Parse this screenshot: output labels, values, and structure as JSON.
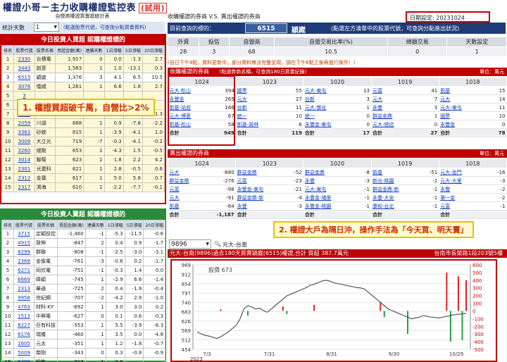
{
  "title": {
    "main": "權證小哥－主力收購權證監控表",
    "note": "(試用)"
  },
  "date_setting": {
    "label": "日期設定:",
    "value": "20231024"
  },
  "left": {
    "header": "自營商權證買賣超統計表",
    "stat_days_label": "統計天數",
    "stat_days_value": "1",
    "stat_hint": "(點選股票代號，可查詢分點買賣資料)",
    "top_title": "今日投資人買超 認購權證標的",
    "top_cols": [
      "排名",
      "股票代號",
      "股票名稱",
      "買超金額(萬)",
      "連續天數",
      "1日漲幅",
      "5日漲幅",
      "20日漲幅"
    ],
    "top_rows": [
      [
        "1",
        "2330",
        "台積電",
        "1,917",
        "0",
        "0.0",
        "-1.3",
        "2.7"
      ],
      [
        "2",
        "3443",
        "創意",
        "1,583",
        "1",
        "1.0",
        "-13.1",
        "0.3"
      ],
      [
        "3",
        "6515",
        "穎崴",
        "1,376",
        "3",
        "4.1",
        "6.5",
        "10.5"
      ],
      [
        "4",
        "3078",
        "僑威",
        "1,261",
        "1",
        "6.6",
        "1.8",
        "2.7"
      ],
      [
        "5",
        "3",
        "",
        "",
        "",
        "",
        "",
        ""
      ],
      [
        "6",
        "3",
        "",
        "",
        "",
        "",
        "",
        ""
      ],
      [
        "7",
        "3324",
        "雙鴻",
        "912",
        "1",
        "3.8",
        "0.5",
        "1.3"
      ],
      [
        "8",
        "2059",
        "川湖",
        "888",
        "1",
        "0.9",
        "-7.8",
        "-2.2"
      ],
      [
        "9",
        "3363",
        "砂統",
        "815",
        "1",
        "-3.9",
        "-4.1",
        "1.0"
      ],
      [
        "10",
        "3008",
        "大立光",
        "719",
        "-7",
        "-0.3",
        "-4.1",
        "-0.2"
      ],
      [
        "11",
        "3260",
        "威剛",
        "653",
        "1",
        "-4.3",
        "1.5",
        "-0.5"
      ],
      [
        "12",
        "3014",
        "聯陽",
        "623",
        "1",
        "1.8",
        "2.2",
        "4.2"
      ],
      [
        "13",
        "2301",
        "光寶科",
        "621",
        "1",
        "2.8",
        "-0.5",
        "0.6"
      ],
      [
        "14",
        "2312",
        "金寶",
        "617",
        "1",
        "5.0",
        "5.8",
        "0.7"
      ],
      [
        "15",
        "2317",
        "鴻海",
        "610",
        "1",
        "-2.2",
        "-7.7",
        "-0.1"
      ]
    ],
    "bottom_title": "今日投資人賣超 認購權證標的",
    "bottom_cols": [
      "排名",
      "股票代號",
      "股票名稱",
      "賣超金額(萬)",
      "連續天數",
      "1日漲幅",
      "5日漲幅",
      "20日漲幅"
    ],
    "bottom_rows": [
      [
        "1",
        "3715",
        "定穎投控",
        "-1,460",
        "-1",
        "-5.3",
        "-11.5",
        "-0.6"
      ],
      [
        "2",
        "4915",
        "致伸",
        "-847",
        "2",
        "0.4",
        "0.9",
        "-1.7"
      ],
      [
        "3",
        "8299",
        "群聯",
        "-808",
        "-1",
        "-2.5",
        "-3.0",
        "-3.1"
      ],
      [
        "4",
        "2368",
        "金像電",
        "-761",
        "-3",
        "-0.6",
        "0.2",
        "-1.7"
      ],
      [
        "5",
        "6271",
        "同欣電",
        "-751",
        "-1",
        "-0.3",
        "1.4",
        "0.0"
      ],
      [
        "6",
        "6669",
        "緯穎",
        "-745",
        "1",
        "-2.9",
        "6.6",
        "-1.4"
      ],
      [
        "7",
        "2313",
        "華通",
        "-725",
        "2",
        "0.4",
        "-1.9",
        "-0.4"
      ],
      [
        "8",
        "9958",
        "世紀鋼",
        "-707",
        "-2",
        "-4.2",
        "2.9",
        "-1.0"
      ],
      [
        "9",
        "4763",
        "材料-KY",
        "-692",
        "1",
        "3.0",
        "3.0",
        "0.2"
      ],
      [
        "10",
        "1513",
        "中興電",
        "-627",
        "0",
        "0.1",
        "0.6",
        "-0.3"
      ],
      [
        "11",
        "8227",
        "巨有科技",
        "-553",
        "1",
        "5.5",
        "-3.9",
        "-6.3"
      ],
      [
        "12",
        "6176",
        "瑞儀",
        "-460",
        "1",
        "3.5",
        "0.0",
        "-4.8"
      ],
      [
        "13",
        "1605",
        "元太",
        "-351",
        "1",
        "1.2",
        "-1.8",
        "-0.7"
      ],
      [
        "14",
        "5009",
        "榮剛",
        "-343",
        "0",
        "0.3",
        "-0.8",
        "-0.9"
      ],
      [
        "15",
        "6409",
        "旭隼",
        "-317",
        "1",
        "-0.9",
        "",
        ""
      ]
    ]
  },
  "right": {
    "header": "收購權證的券商 V.S. 賣出權證的券商",
    "query_label": "目前查詢的標的：",
    "stock_code": "6515",
    "stock_name": "穎崴",
    "query_hint": "(點選左方清單中的股票代號，可查詢分點進出狀況)",
    "summary_cols": [
      "外資",
      "投信",
      "自營商",
      "自營交易比率(%)",
      "總額交易",
      "天數設定"
    ],
    "summary_vals": [
      "28",
      "3",
      "68",
      "10.5",
      "0",
      "1"
    ],
    "note": "(自日下午4點，資料更新中，部分資料無法完整呈現，請在下午6點之後再進行操作！)",
    "buy_title": "收購權證的券商",
    "buy_sub": "(點選券商名稱，可查詢180日買賣紀錄)",
    "unit": "單位：萬元",
    "dates": [
      "1024",
      "1023",
      "1020",
      "1019",
      "1018"
    ],
    "buy_cols": [
      [
        [
          "元大-松山",
          "394"
        ],
        [
          "永豐金",
          "265"
        ],
        [
          "凱基-站前",
          "166"
        ],
        [
          "元大-博愛",
          "67"
        ],
        [
          "凱基-松山",
          "58"
        ]
      ],
      [
        [
          "國票",
          "55"
        ],
        [
          "元大",
          "27"
        ],
        [
          "台新",
          "11"
        ],
        [
          "統一",
          "10"
        ],
        [
          "凱基-員林",
          "6"
        ]
      ],
      [
        [
          "元大-東屯",
          "13"
        ],
        [
          "台新",
          "3"
        ],
        [
          "元大-敦化",
          "1"
        ],
        [
          "統一",
          "0"
        ],
        [
          "永豐金-東屯",
          "0"
        ]
      ],
      [
        [
          "元富",
          "41"
        ],
        [
          "元大",
          "7"
        ],
        [
          "永豐",
          "3"
        ],
        [
          "群益金鼎",
          "1"
        ],
        [
          "元大-總店",
          "0"
        ]
      ],
      [
        [
          "凱基",
          "15"
        ],
        [
          "元大",
          "14"
        ],
        [
          "元大-東屯",
          "11"
        ],
        [
          "國票",
          "10"
        ],
        [
          "永豐金",
          "0"
        ]
      ]
    ],
    "buy_totals": [
      "949",
      "119",
      "17",
      "27",
      "78"
    ],
    "total_label": "合計",
    "sell_title": "賣出權證的券商",
    "sell_cols": [
      [
        [
          "元大",
          "-680"
        ],
        [
          "群益金鼎",
          "-276"
        ],
        [
          "元富",
          "-98"
        ],
        [
          "元大",
          "-91"
        ],
        [
          "凱基",
          "-64"
        ]
      ],
      [
        [
          "群益金鼎",
          "-52"
        ],
        [
          "元富",
          "-23"
        ],
        [
          "永豐金-東屯",
          "-21"
        ],
        [
          "群益金鼎-新",
          "-4"
        ],
        [
          "永豐",
          "-3"
        ]
      ],
      [
        [
          "群益金鼎",
          "-8"
        ],
        [
          "永豐",
          "-3"
        ],
        [
          "元大-東屯",
          "-1"
        ],
        [
          "永豐金-埔里",
          "-1"
        ],
        [
          "永豐金-桃園",
          "-1"
        ]
      ],
      [
        [
          "凱基",
          "-51"
        ],
        [
          "新光-桃園",
          "-2"
        ],
        [
          "群益金鼎-新",
          "-1"
        ],
        [
          "永豐-大安",
          "-1"
        ],
        [
          "康和-台北",
          "-1"
        ]
      ],
      [
        [
          "元大-金門",
          "-16"
        ],
        [
          "元大-大里",
          "-3"
        ],
        [
          "永豐",
          "-2"
        ],
        [
          "第一金",
          "-2"
        ],
        [
          "元富",
          "-1"
        ]
      ]
    ],
    "sell_totals": [
      "-1,187",
      "",
      "",
      "",
      ""
    ]
  },
  "callouts": {
    "c1": "1. 權證買超破千萬，自營比>2%",
    "c2": "2. 權證大戶為隔日沖，操作手法為「今天買、明天賣」"
  },
  "chart": {
    "select_value": "9896",
    "broker_label": "元大-台南",
    "title": "元大-台南(9896)過去180天買賣穎崴(6515)權證,合計 買超 387.7萬元",
    "address": "台南市長榮路1段203號5樓",
    "legend": "股價 673",
    "year": "2023"
  },
  "chart_data": {
    "type": "line",
    "x_labels": [
      "7/3",
      "7/31",
      "8/31",
      "9/30",
      "10/29"
    ],
    "y_left_ticks": [
      969,
      912,
      854,
      797,
      740,
      683,
      626,
      569,
      512,
      454
    ],
    "y_right_ticks": [
      600,
      500,
      400,
      300,
      200,
      100,
      0,
      -100,
      -200,
      -300,
      -400,
      -500
    ],
    "price": [
      560,
      548,
      540,
      535,
      528,
      520,
      530,
      545,
      560,
      580,
      600,
      640,
      700,
      720,
      712,
      700,
      705,
      690,
      680,
      700,
      720,
      740,
      760,
      780,
      790,
      800,
      810,
      820,
      830,
      845,
      850,
      860,
      870,
      875,
      870,
      860,
      855,
      850,
      845,
      840,
      835,
      830,
      828,
      820,
      800,
      780,
      760,
      740,
      720,
      700,
      690,
      680,
      670,
      660,
      650,
      640,
      645,
      650,
      660,
      655,
      650,
      648,
      645,
      650,
      655,
      660,
      665,
      668,
      670,
      673
    ],
    "buy_sell": [
      0,
      0,
      0,
      0,
      0,
      0,
      20,
      0,
      0,
      0,
      0,
      0,
      0,
      -60,
      0,
      0,
      0,
      0,
      0,
      0,
      0,
      0,
      60,
      -40,
      0,
      0,
      0,
      0,
      0,
      0,
      80,
      0,
      0,
      0,
      0,
      0,
      0,
      0,
      0,
      0,
      0,
      0,
      0,
      0,
      0,
      0,
      0,
      120,
      -80,
      0,
      0,
      0,
      0,
      0,
      -300,
      0,
      0,
      0,
      0,
      0,
      0,
      0,
      0,
      0,
      500,
      -400,
      0,
      450,
      -380,
      400
    ]
  }
}
